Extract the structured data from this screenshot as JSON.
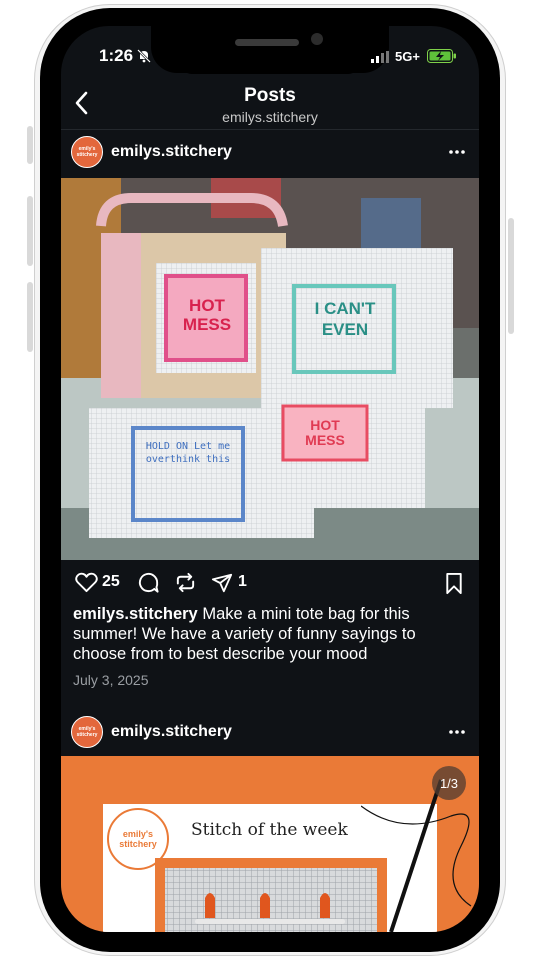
{
  "status_bar": {
    "time": "1:26",
    "network": "5G+"
  },
  "header": {
    "title": "Posts",
    "subtitle": "emilys.stitchery"
  },
  "post1": {
    "username": "emilys.stitchery",
    "avatar_text": "emily's stitchery",
    "photo": {
      "canvas1": "HOT MESS",
      "canvas2": "I CAN'T EVEN",
      "canvas3": "HOLD ON Let me overthink this",
      "canvas4": "HOT MESS"
    },
    "likes": "25",
    "reposts": "1",
    "caption_user": "emilys.stitchery",
    "caption_text": " Make a mini tote bag for this summer! We have a variety of funny sayings to choose from to best describe your mood",
    "date": "July 3, 2025"
  },
  "post2": {
    "username": "emilys.stitchery",
    "avatar_text": "emily's stitchery",
    "card_title": "Stitch of the week",
    "card_logo_line1": "emily's",
    "card_logo_line2": "stitchery",
    "page_counter": "1/3"
  },
  "colors": {
    "background": "#0f1216",
    "accent": "#e3673c",
    "post2_bg": "#ea7a37"
  },
  "icons": [
    "bell-mute-icon",
    "signal-icon",
    "battery-icon",
    "back-icon",
    "more-icon",
    "heart-icon",
    "comment-icon",
    "repost-icon",
    "send-icon",
    "bookmark-icon"
  ]
}
